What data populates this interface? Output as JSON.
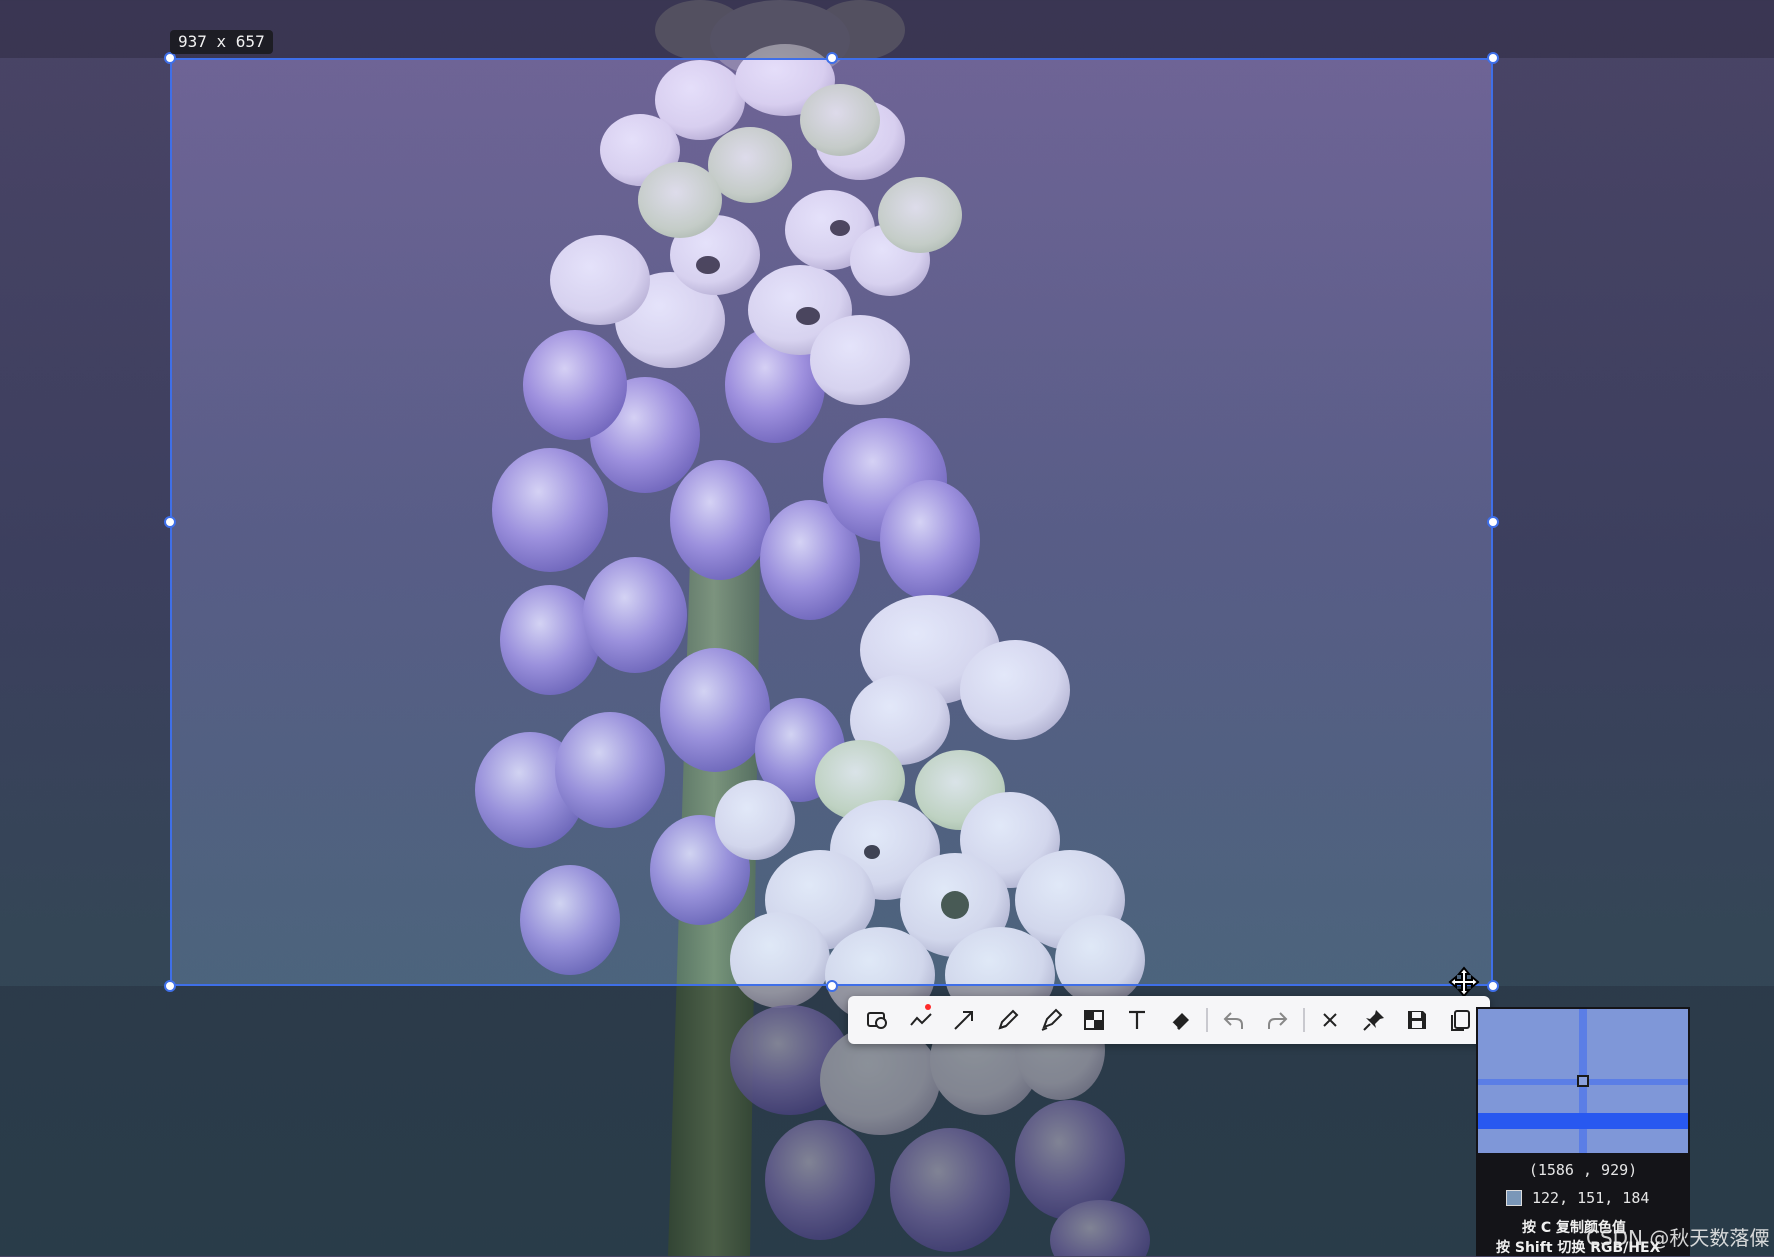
{
  "selection": {
    "size_label": "937 x 657"
  },
  "toolbar": {
    "tools": [
      {
        "name": "rectangle-tool-icon"
      },
      {
        "name": "curve-tool-icon"
      },
      {
        "name": "arrow-tool-icon"
      },
      {
        "name": "pencil-tool-icon"
      },
      {
        "name": "marker-tool-icon"
      },
      {
        "name": "mosaic-tool-icon"
      },
      {
        "name": "text-tool-icon"
      },
      {
        "name": "eraser-tool-icon"
      },
      {
        "name": "undo-icon"
      },
      {
        "name": "redo-icon"
      },
      {
        "name": "close-icon"
      },
      {
        "name": "pin-icon"
      },
      {
        "name": "save-icon"
      },
      {
        "name": "copy-icon"
      }
    ]
  },
  "magnifier": {
    "coords": "(1586 , 929)",
    "rgb": "122, 151, 184",
    "swatch_color": "#7a97b8",
    "hint_copy": "按 C 复制颜色值",
    "hint_switch": "按 Shift 切换 RGB/HEX"
  },
  "watermark": "CSDN @秋天数落僳",
  "colors": {
    "accent": "#3f6fe8",
    "recording_dot": "#ff2a2a"
  }
}
